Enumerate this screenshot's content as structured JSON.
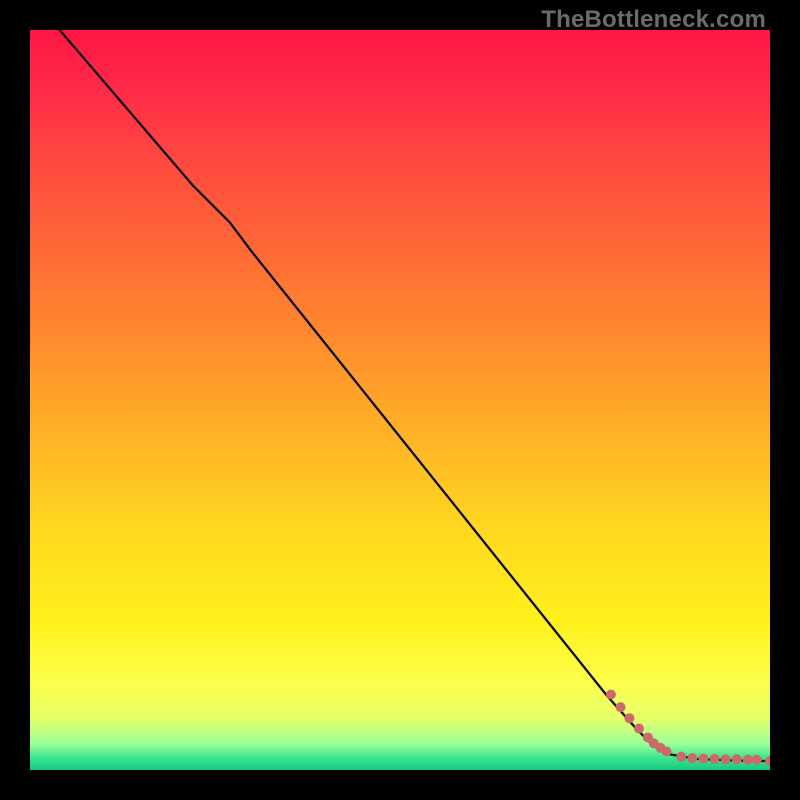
{
  "watermark": "TheBottleneck.com",
  "gradient_stops": [
    {
      "offset": 0.0,
      "color": "#ff1744"
    },
    {
      "offset": 0.08,
      "color": "#ff2a48"
    },
    {
      "offset": 0.18,
      "color": "#ff4a3f"
    },
    {
      "offset": 0.3,
      "color": "#ff6a36"
    },
    {
      "offset": 0.42,
      "color": "#ff8c2e"
    },
    {
      "offset": 0.55,
      "color": "#ffb326"
    },
    {
      "offset": 0.68,
      "color": "#ffd91f"
    },
    {
      "offset": 0.8,
      "color": "#fff11c"
    },
    {
      "offset": 0.88,
      "color": "#fdff4a"
    },
    {
      "offset": 0.93,
      "color": "#e7ff6a"
    },
    {
      "offset": 0.965,
      "color": "#99ff99"
    },
    {
      "offset": 0.985,
      "color": "#34e38f"
    },
    {
      "offset": 1.0,
      "color": "#17c97f"
    }
  ],
  "point_color": "#cc6a6a",
  "chart_data": {
    "type": "line",
    "title": "",
    "xlabel": "",
    "ylabel": "",
    "xlim": [
      0,
      100
    ],
    "ylim": [
      0,
      100
    ],
    "series": [
      {
        "name": "curve",
        "x": [
          4,
          10,
          16,
          22,
          27,
          30,
          40,
          50,
          60,
          70,
          78,
          82,
          84,
          86,
          90,
          95,
          100
        ],
        "y": [
          100,
          93,
          86,
          79,
          74,
          70,
          57.5,
          45,
          32.5,
          20,
          10,
          5.5,
          3.5,
          2.2,
          1.5,
          1.3,
          1.2
        ]
      }
    ],
    "scatter": {
      "name": "points",
      "color": "#cc6a6a",
      "x": [
        78.5,
        79.8,
        81.0,
        82.3,
        83.5,
        84.3,
        85.2,
        86.0,
        88.0,
        89.5,
        91.0,
        92.5,
        94.0,
        95.5,
        97.0,
        98.2,
        100.0
      ],
      "y": [
        10.2,
        8.5,
        7.0,
        5.6,
        4.4,
        3.6,
        3.0,
        2.5,
        1.8,
        1.6,
        1.55,
        1.5,
        1.45,
        1.45,
        1.4,
        1.4,
        1.2
      ]
    }
  }
}
